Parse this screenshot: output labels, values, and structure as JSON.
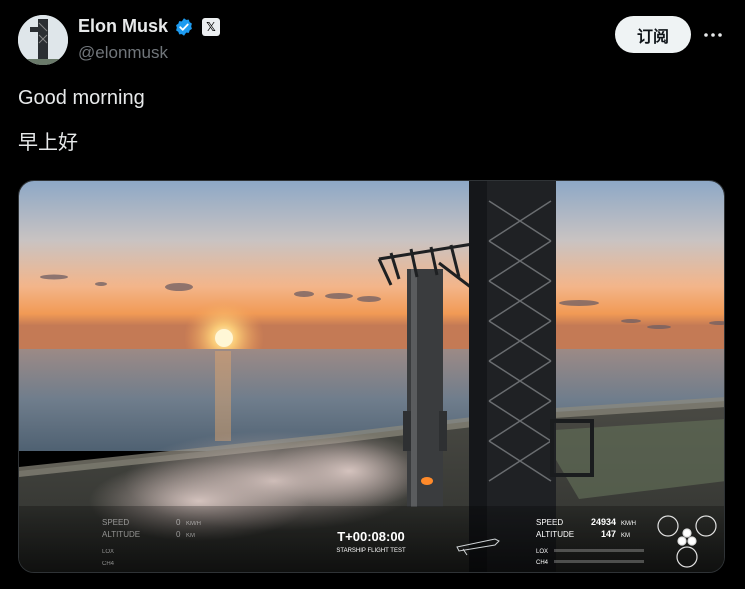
{
  "author": {
    "name": "Elon Musk",
    "handle": "@elonmusk",
    "x_badge": "𝕏"
  },
  "actions": {
    "subscribe_label": "订阅"
  },
  "post": {
    "line1": "Good morning",
    "line2": "早上好"
  },
  "telemetry": {
    "left": {
      "speed_label": "SPEED",
      "speed_value": "0",
      "speed_unit": "KM/H",
      "altitude_label": "ALTITUDE",
      "altitude_value": "0",
      "altitude_unit": "KM",
      "lox_label": "LOX",
      "ch4_label": "CH4"
    },
    "timer": "T+00:08:00",
    "subtitle": "STARSHIP FLIGHT TEST",
    "right": {
      "speed_label": "SPEED",
      "speed_value": "24934",
      "speed_unit": "KM/H",
      "altitude_label": "ALTITUDE",
      "altitude_value": "147",
      "altitude_unit": "KM",
      "lox_label": "LOX",
      "ch4_label": "CH4"
    }
  },
  "colors": {
    "verified": "#1d9bf0",
    "sky_top": "#7f9fc0",
    "horizon": "#f6a35a",
    "sun": "#ffe9a8"
  }
}
